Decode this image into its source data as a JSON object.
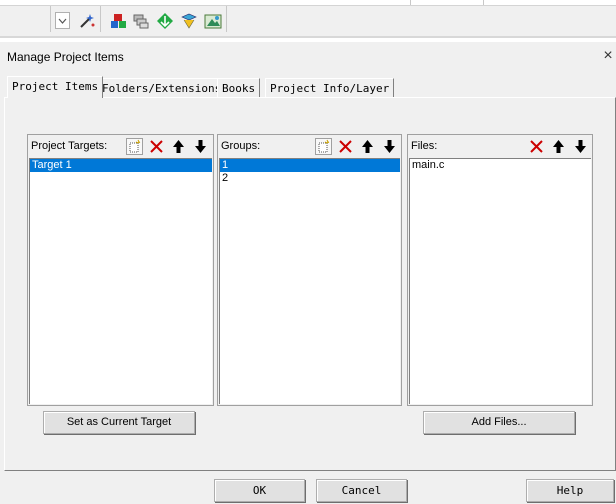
{
  "dialog": {
    "title": "Manage Project Items",
    "close_glyph": "×"
  },
  "tabs": [
    {
      "label": "Project Items",
      "active": true
    },
    {
      "label": "Folders/Extensions",
      "active": false
    },
    {
      "label": "Books",
      "active": false
    },
    {
      "label": "Project Info/Layer",
      "active": false
    }
  ],
  "targets": {
    "label": "Project Targets:",
    "items": [
      {
        "text": "Target 1",
        "selected": true
      }
    ],
    "button": "Set as Current Target"
  },
  "groups": {
    "label": "Groups:",
    "items": [
      {
        "text": "1",
        "selected": true
      },
      {
        "text": "2",
        "selected": false
      }
    ]
  },
  "files": {
    "label": "Files:",
    "items": [
      {
        "text": "main.c",
        "selected": false
      }
    ],
    "button": "Add Files..."
  },
  "footer": {
    "ok": "OK",
    "cancel": "Cancel",
    "help": "Help"
  },
  "icons": {
    "new": "new-item-icon",
    "delete": "delete-icon",
    "up": "move-up-icon",
    "down": "move-down-icon",
    "toolbar": [
      "combo-dropdown-icon",
      "magic-wand-icon",
      "translate-icon",
      "batch-build-icon",
      "download-icon",
      "debug-icon",
      "project-icon"
    ]
  },
  "colors": {
    "selection": "#0078d7",
    "delete": "#cc0000"
  }
}
